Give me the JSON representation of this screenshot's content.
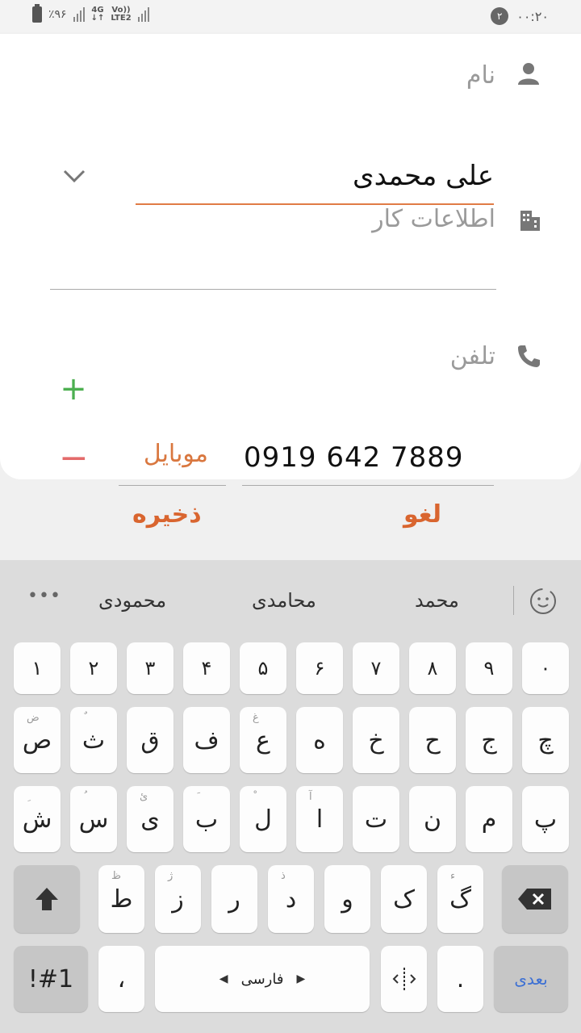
{
  "status_bar": {
    "battery": "٪۹۶",
    "network_1": "4G",
    "network_2": "Vo))",
    "network_3": "LTE2",
    "time": "۰۰:۲۰",
    "notification_count": "۲"
  },
  "form": {
    "name_label": "نام",
    "name_value": "علی محمدی",
    "work_label": "اطلاعات کار",
    "phone_label": "تلفن",
    "phone_type": "موبایل",
    "phone_value": "0919 642 7889"
  },
  "actions": {
    "save": "ذخیره",
    "cancel": "لغو"
  },
  "keyboard": {
    "suggestions": [
      "محمد",
      "محامدی",
      "محمودی"
    ],
    "more": "•••",
    "number_row": [
      "۱",
      "۲",
      "۳",
      "۴",
      "۵",
      "۶",
      "۷",
      "۸",
      "۹",
      "۰"
    ],
    "row1": [
      {
        "ch": "ص",
        "hint": "ض"
      },
      {
        "ch": "ث",
        "hint": "ٌ"
      },
      {
        "ch": "ق",
        "hint": ""
      },
      {
        "ch": "ف",
        "hint": ""
      },
      {
        "ch": "ع",
        "hint": "غ"
      },
      {
        "ch": "ه",
        "hint": ""
      },
      {
        "ch": "خ",
        "hint": ""
      },
      {
        "ch": "ح",
        "hint": ""
      },
      {
        "ch": "ج",
        "hint": ""
      },
      {
        "ch": "چ",
        "hint": ""
      }
    ],
    "row2": [
      {
        "ch": "ش",
        "hint": "ِ"
      },
      {
        "ch": "س",
        "hint": "ُ"
      },
      {
        "ch": "ی",
        "hint": "ئ"
      },
      {
        "ch": "ب",
        "hint": "َ"
      },
      {
        "ch": "ل",
        "hint": "ْ"
      },
      {
        "ch": "ا",
        "hint": "آ"
      },
      {
        "ch": "ت",
        "hint": ""
      },
      {
        "ch": "ن",
        "hint": ""
      },
      {
        "ch": "م",
        "hint": ""
      },
      {
        "ch": "پ",
        "hint": ""
      }
    ],
    "row3": [
      {
        "ch": "ط",
        "hint": "ظ"
      },
      {
        "ch": "ز",
        "hint": "ژ"
      },
      {
        "ch": "ر",
        "hint": ""
      },
      {
        "ch": "د",
        "hint": "ذ"
      },
      {
        "ch": "و",
        "hint": ""
      },
      {
        "ch": "ک",
        "hint": ""
      },
      {
        "ch": "گ",
        "hint": "ء"
      }
    ],
    "symbols_key": "!#1",
    "comma_key": "،",
    "space_label": "فارسی",
    "period_key": ".",
    "next_key": "بعدی"
  }
}
